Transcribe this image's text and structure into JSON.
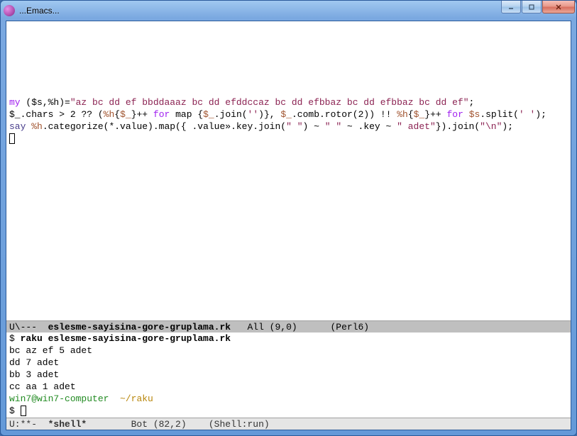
{
  "window": {
    "title": "...Emacs..."
  },
  "editor": {
    "code_tokens": {
      "l1_my": "my",
      "l1_vars": " ($s,%h)=",
      "l1_str": "\"az bc dd ef bbddaaaz bc dd efddccaz bc dd efbbaz bc dd efbbaz bc dd ef\"",
      "l1_term": ";",
      "l2_a": "$_.chars > ",
      "l2_two": "2",
      "l2_b": " ?? (",
      "l2_hash1": "%h",
      "l2_c": "{",
      "l2_topic1": "$_",
      "l2_d": "}++ ",
      "l2_for1": "for",
      "l2_e": " map {",
      "l2_topic2": "$_",
      "l2_f": ".join(",
      "l2_empty": "''",
      "l2_g": ")}, ",
      "l2_topic3": "$_",
      "l2_h": ".comb.rotor(",
      "l2_two2": "2",
      "l2_i": ")) !! ",
      "l2_hash2": "%h",
      "l2_j": "{",
      "l2_topic4": "$_",
      "l2_k": "}++ ",
      "l2_for2": "for",
      "l2_l": " ",
      "l2_s": "$s",
      "l2_m": ".split(",
      "l2_space": "' '",
      "l2_n": ");",
      "l3_say": "say",
      "l3_a": " ",
      "l3_hash": "%h",
      "l3_b": ".categorize(*.value).map({ .value».key.join(",
      "l3_s1": "\" \"",
      "l3_c": ") ~ ",
      "l3_s2": "\" \"",
      "l3_d": " ~ .key ~ ",
      "l3_s3": "\" adet\"",
      "l3_e": "}).join(",
      "l3_s4": "\"\\n\"",
      "l3_f": ");"
    }
  },
  "modeline_top": {
    "left": "U\\---  ",
    "buffer": "eslesme-sayisina-gore-gruplama.rk",
    "pos": "   All (9,0)      ",
    "mode": "(Perl6)"
  },
  "shell": {
    "prompt1": "$ ",
    "cmd": "raku eslesme-sayisina-gore-gruplama.rk",
    "out1": "bc az ef 5 adet",
    "out2": "dd 7 adet",
    "out3": "bb 3 adet",
    "out4": "cc aa 1 adet",
    "user": "win7@win7-computer",
    "path": "  ~/raku",
    "prompt2": "$ "
  },
  "modeline_bot": {
    "left": "U:**-  ",
    "buffer": "*shell*",
    "pos": "        Bot (82,2)    ",
    "mode": "(Shell:run)"
  }
}
